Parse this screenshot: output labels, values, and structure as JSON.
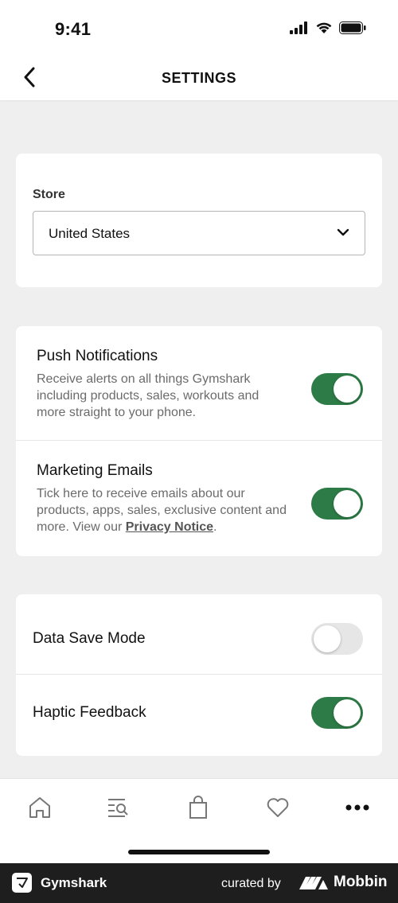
{
  "status_bar": {
    "time": "9:41"
  },
  "header": {
    "title": "SETTINGS"
  },
  "store": {
    "label": "Store",
    "selected": "United States"
  },
  "notifications": {
    "push": {
      "title": "Push Notifications",
      "description": "Receive alerts on all things Gymshark including products, sales, workouts and more straight to your phone.",
      "enabled": true
    },
    "marketing": {
      "title": "Marketing Emails",
      "description_prefix": "Tick here to receive emails about our products, apps, sales, exclusive content and more. View our ",
      "link_text": "Privacy Notice",
      "description_suffix": ".",
      "enabled": true
    }
  },
  "preferences": {
    "data_save": {
      "label": "Data Save Mode",
      "enabled": false
    },
    "haptic": {
      "label": "Haptic Feedback",
      "enabled": true
    }
  },
  "tabs": [
    "home-icon",
    "search-list-icon",
    "bag-icon",
    "heart-icon",
    "more-icon"
  ],
  "colors": {
    "accent": "#2d7b46",
    "toggle_off": "#e6e6e6",
    "background": "#efefef"
  },
  "footer": {
    "brand": "Gymshark",
    "curated_by": "curated by",
    "platform": "Mobbin"
  }
}
